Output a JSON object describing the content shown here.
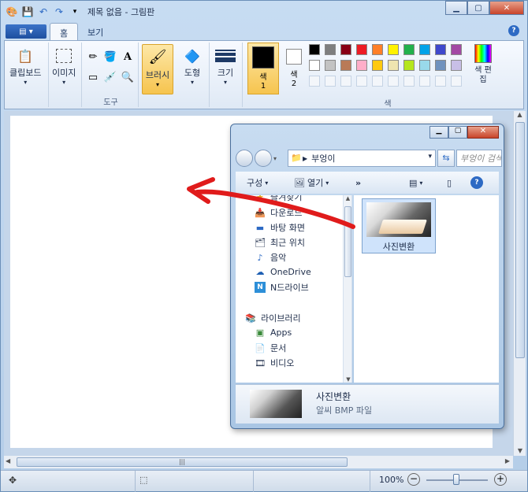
{
  "app": {
    "title": "제목 없음 - 그림판"
  },
  "ribbon": {
    "tabs": [
      {
        "label": "홈"
      },
      {
        "label": "보기"
      }
    ],
    "clipboard": {
      "label": "클립보드"
    },
    "image": {
      "label": "이미지"
    },
    "tools": {
      "group_label": "도구"
    },
    "brush": {
      "label": "브러시"
    },
    "shapes": {
      "label": "도형"
    },
    "size": {
      "label": "크기"
    },
    "color1": {
      "label": "색",
      "sub": "1"
    },
    "color2": {
      "label": "색",
      "sub": "2"
    },
    "colors": {
      "group_label": "색"
    },
    "edit_colors": {
      "label": "색 편집"
    },
    "palette_row1": [
      "#000000",
      "#7f7f7f",
      "#880015",
      "#ed1c24",
      "#ff7f27",
      "#fff200",
      "#22b14c",
      "#00a2e8",
      "#3f48cc",
      "#a349a4"
    ],
    "palette_row2": [
      "#ffffff",
      "#c3c3c3",
      "#b97a57",
      "#ffaec9",
      "#ffc90e",
      "#efe4b0",
      "#b5e61d",
      "#99d9ea",
      "#7092be",
      "#c8bfe7"
    ]
  },
  "explorer": {
    "address": "부엉이",
    "search_placeholder": "부엉이 검색",
    "commands": {
      "organize": "구성",
      "open": "열기",
      "more": "»"
    },
    "nav_items": [
      {
        "label": "즐겨찾기",
        "icon": "star-icon"
      },
      {
        "label": "다운로드",
        "icon": "download-folder-icon"
      },
      {
        "label": "바탕 화면",
        "icon": "desktop-icon"
      },
      {
        "label": "최근 위치",
        "icon": "recent-places-icon"
      },
      {
        "label": "음악",
        "icon": "music-icon"
      },
      {
        "label": "OneDrive",
        "icon": "onedrive-icon"
      },
      {
        "label": "N드라이브",
        "icon": "ndrive-icon"
      },
      {
        "label": "라이브러리",
        "icon": "library-icon"
      },
      {
        "label": "Apps",
        "icon": "apps-icon"
      },
      {
        "label": "문서",
        "icon": "documents-icon"
      },
      {
        "label": "비디오",
        "icon": "video-icon"
      }
    ],
    "file": {
      "name": "사진변환"
    },
    "details": {
      "name": "사진변환",
      "type": "알씨 BMP 파일"
    }
  },
  "status": {
    "zoom": "100%"
  },
  "colors": {
    "accent_arrow": "#e01b1b"
  }
}
